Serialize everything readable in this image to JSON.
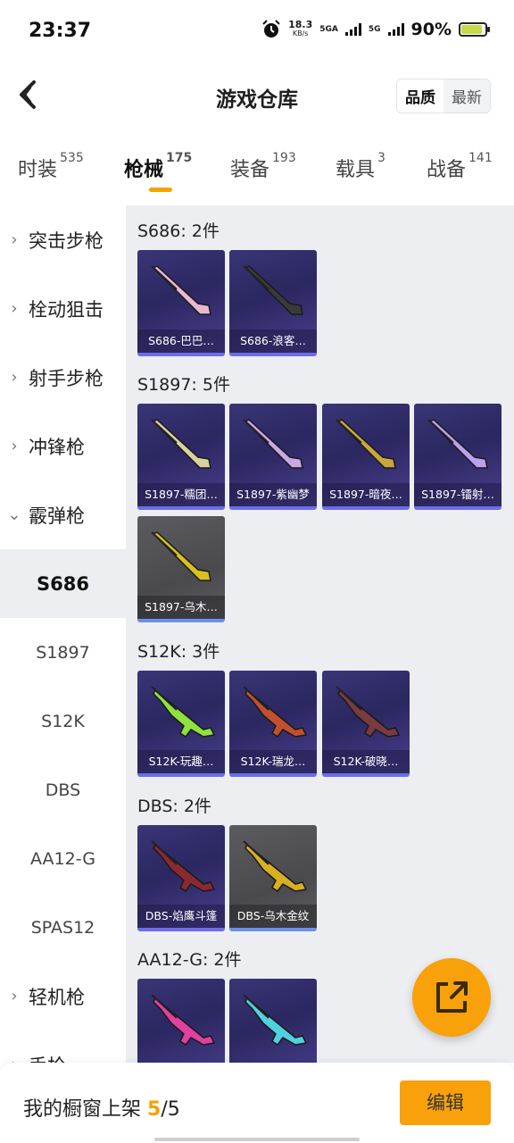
{
  "status_bar": {
    "time": "23:37",
    "speed_value": "18.3",
    "speed_unit": "KB/s",
    "network_1": "5GA",
    "network_2": "5G",
    "battery_text": "90%",
    "battery_level": 0.9
  },
  "header": {
    "title": "游戏仓库",
    "sort_options": [
      "品质",
      "最新"
    ],
    "active_sort": "品质"
  },
  "tabs": [
    {
      "label": "时装",
      "count": "535"
    },
    {
      "label": "枪械",
      "count": "175",
      "active": true
    },
    {
      "label": "装备",
      "count": "193"
    },
    {
      "label": "载具",
      "count": "3"
    },
    {
      "label": "战备",
      "count": "141"
    }
  ],
  "sidebar": [
    {
      "label": "突击步枪",
      "type": "category"
    },
    {
      "label": "栓动狙击",
      "type": "category"
    },
    {
      "label": "射手步枪",
      "type": "category"
    },
    {
      "label": "冲锋枪",
      "type": "category"
    },
    {
      "label": "霰弹枪",
      "type": "category",
      "expanded": true
    },
    {
      "label": "S686",
      "type": "sub",
      "active": true
    },
    {
      "label": "S1897",
      "type": "sub"
    },
    {
      "label": "S12K",
      "type": "sub"
    },
    {
      "label": "DBS",
      "type": "sub"
    },
    {
      "label": "AA12-G",
      "type": "sub"
    },
    {
      "label": "SPAS12",
      "type": "sub"
    },
    {
      "label": "轻机枪",
      "type": "category"
    },
    {
      "label": "手枪",
      "type": "category"
    }
  ],
  "groups": [
    {
      "title": "S686: 2件",
      "items": [
        {
          "label": "S686-巴巴…",
          "style": "purple",
          "accent": "#e8b8d0"
        },
        {
          "label": "S686-浪客…",
          "style": "purple",
          "accent": "#3a3a3a"
        }
      ]
    },
    {
      "title": "S1897: 5件",
      "items": [
        {
          "label": "S1897-糯团…",
          "style": "purple",
          "accent": "#d8d2a0"
        },
        {
          "label": "S1897-紫幽梦",
          "style": "purple",
          "accent": "#c9a7e8"
        },
        {
          "label": "S1897-暗夜…",
          "style": "purple",
          "accent": "#c9a640"
        },
        {
          "label": "S1897-镭射…",
          "style": "purple",
          "accent": "#b9a0f0"
        },
        {
          "label": "S1897-乌木…",
          "style": "gray",
          "accent": "#d8c020"
        }
      ]
    },
    {
      "title": "S12K: 3件",
      "items": [
        {
          "label": "S12K-玩趣…",
          "style": "purple",
          "accent": "#8fe040"
        },
        {
          "label": "S12K-瑞龙…",
          "style": "purple",
          "accent": "#c0502e"
        },
        {
          "label": "S12K-破晓…",
          "style": "purple",
          "accent": "#7a3a40"
        }
      ]
    },
    {
      "title": "DBS: 2件",
      "items": [
        {
          "label": "DBS-焰鹰斗篷",
          "style": "purple",
          "accent": "#8a2a30"
        },
        {
          "label": "DBS-乌木金纹",
          "style": "gray",
          "accent": "#d8b020"
        }
      ]
    },
    {
      "title": "AA12-G: 2件",
      "items": [
        {
          "label": "",
          "style": "purple",
          "accent": "#e040a0"
        },
        {
          "label": "",
          "style": "purple",
          "accent": "#50d0e0"
        }
      ]
    }
  ],
  "bottom_bar": {
    "text_prefix": "我的橱窗上架",
    "count_current": "5",
    "count_total": "/5",
    "edit_label": "编辑"
  },
  "colors": {
    "accent": "#f8a10a",
    "content_bg": "#eceef2",
    "card_purple": "#2b2760",
    "card_gray": "#4a4a4e"
  }
}
